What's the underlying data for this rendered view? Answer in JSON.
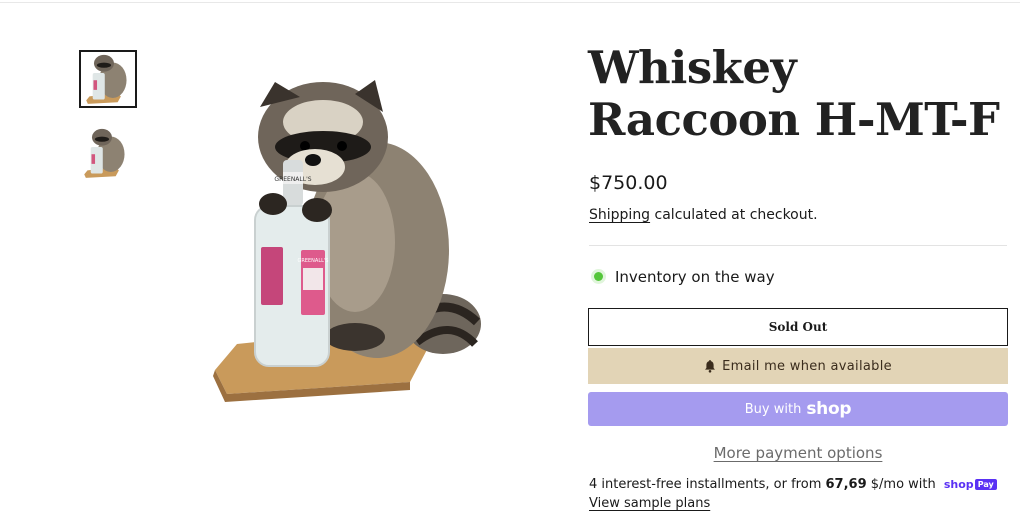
{
  "product": {
    "title": "Whiskey Raccoon H-MT-F",
    "price": "$750.00",
    "shipping_link": "Shipping",
    "shipping_rest": " calculated at checkout.",
    "inventory_status": "Inventory on the way"
  },
  "gallery": {
    "thumbnails": [
      {
        "name": "thumbnail-1",
        "selected": true
      },
      {
        "name": "thumbnail-2",
        "selected": false
      }
    ],
    "bottle_labels": {
      "neck": "GREENALL'S",
      "body": "GREENALL'S"
    }
  },
  "buttons": {
    "sold_out": "Sold Out",
    "email_me": "Email me when available",
    "email_icon": "bell-icon",
    "buy_with": "Buy with",
    "shop_word": "shop",
    "more_payment": "More payment options"
  },
  "installments": {
    "prefix": "4 interest-free installments, or from ",
    "amount": "67,69",
    "suffix": " $/mo with ",
    "shop_pay_word": "shop",
    "shop_pay_badge": "Pay",
    "view_plans": "View sample plans"
  },
  "colors": {
    "inventory_dot": "#54c63a",
    "email_button_bg": "#e2d4b6",
    "shop_button_bg": "#a59bef",
    "shop_pay_purple": "#5a31f4"
  }
}
